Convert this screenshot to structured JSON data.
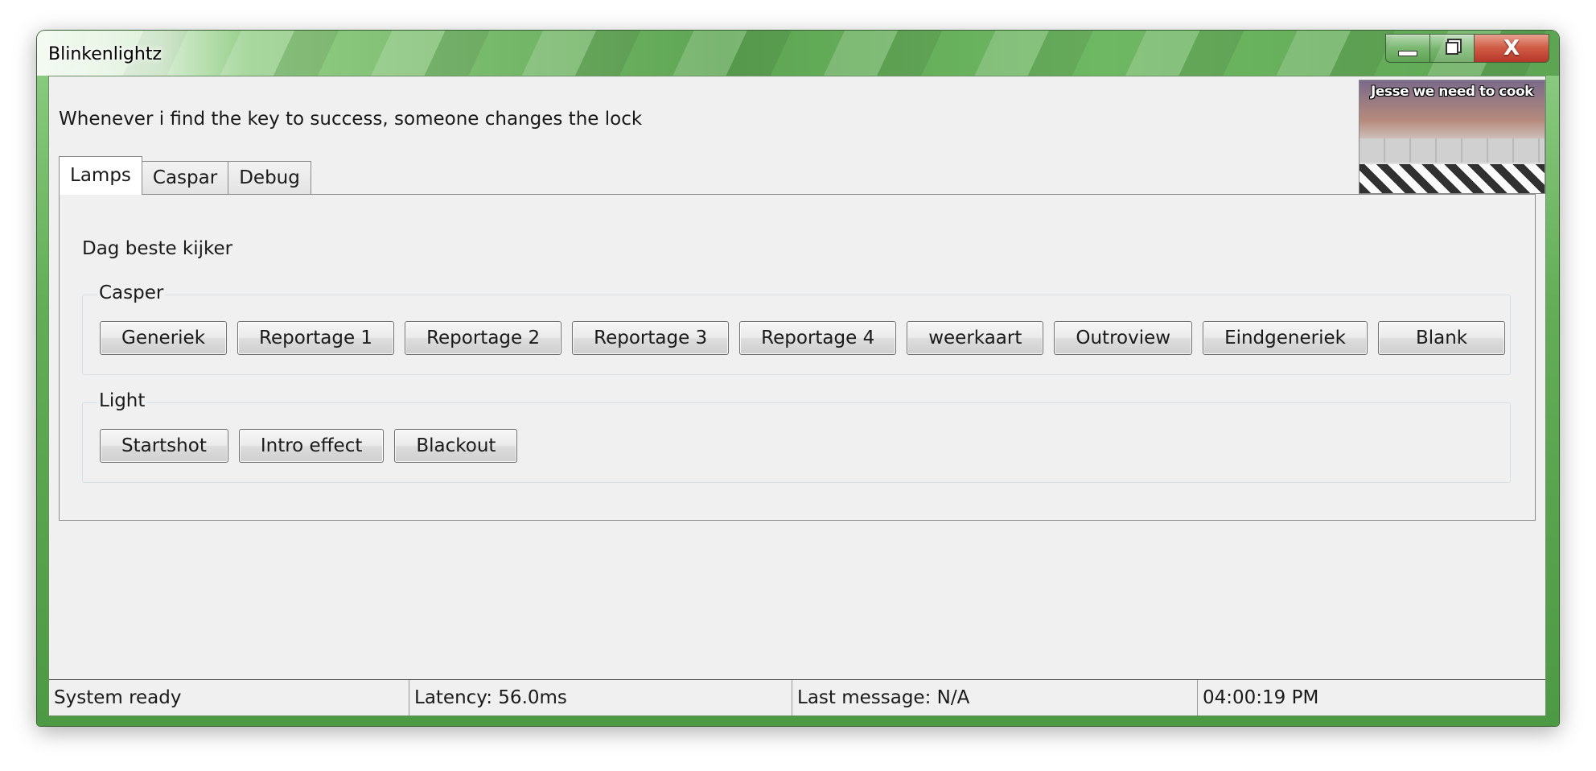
{
  "window": {
    "title": "Blinkenlightz",
    "caption_buttons": {
      "minimize_icon": "minimize-icon",
      "maximize_icon": "restore-icon",
      "close_label": "X"
    }
  },
  "header": {
    "quote": "Whenever i find the key to success, someone changes the lock",
    "thumbnail_caption": "Jesse we need to cook"
  },
  "tabs": [
    {
      "label": "Lamps",
      "active": true
    },
    {
      "label": "Caspar",
      "active": false
    },
    {
      "label": "Debug",
      "active": false
    }
  ],
  "lamps": {
    "greeting": "Dag beste kijker",
    "casper": {
      "legend": "Casper",
      "buttons": [
        "Generiek",
        "Reportage 1",
        "Reportage 2",
        "Reportage 3",
        "Reportage 4",
        "weerkaart",
        "Outroview",
        "Eindgeneriek",
        "Blank"
      ]
    },
    "light": {
      "legend": "Light",
      "buttons": [
        "Startshot",
        "Intro effect",
        "Blackout"
      ]
    }
  },
  "status": {
    "ready": "System ready",
    "latency": "Latency: 56.0ms",
    "last_message": "Last message: N/A",
    "time": "04:00:19 PM"
  },
  "colors": {
    "frame_accent": "#62ad56",
    "close_button": "#cf5a43",
    "client_bg": "#f0f0f0"
  }
}
